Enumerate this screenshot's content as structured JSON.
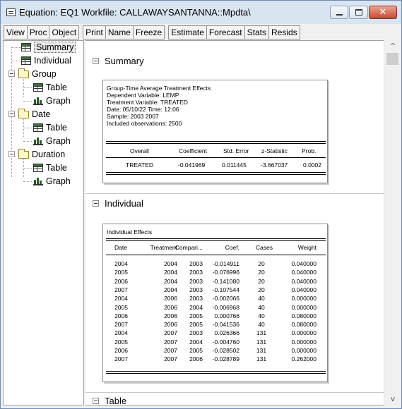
{
  "window": {
    "title": "Equation: EQ1   Workfile: CALLAWAYSANTANNA::Mpdta\\",
    "close_glyph": "✕"
  },
  "toolbar": {
    "group1": [
      "View",
      "Proc",
      "Object"
    ],
    "group2": [
      "Print",
      "Name",
      "Freeze"
    ],
    "group3": [
      "Estimate",
      "Forecast",
      "Stats",
      "Resids"
    ]
  },
  "tree": {
    "summary": "Summary",
    "individual": "Individual",
    "group": "Group",
    "group_table": "Table",
    "group_graph": "Graph",
    "date": "Date",
    "date_table": "Table",
    "date_graph": "Graph",
    "duration": "Duration",
    "duration_table": "Table",
    "duration_graph": "Graph"
  },
  "summary": {
    "heading": "Summary",
    "meta": [
      "Group-Time Average Treatment Effects",
      "Dependent Variable: LEMP",
      "Treatment Variable:  TREATED",
      "Date: 05/10/22   Time: 12:06",
      "Sample: 2003 2007",
      "Included observations: 2500"
    ],
    "columns": [
      "Overall",
      "Coefficient",
      "Std. Error",
      "z-Statistic",
      "Prob."
    ],
    "row": [
      "TREATED",
      "-0.041969",
      "0.011445",
      "-3.667037",
      "0.0002"
    ]
  },
  "individual": {
    "heading": "Individual",
    "caption": "Individual Effects",
    "columns": [
      "Date",
      "Treatment",
      "Compari...",
      "Coef.",
      "Cases",
      "Weight"
    ],
    "rows": [
      [
        "2004",
        "2004",
        "2003",
        "-0.014911",
        "20",
        "0.040000"
      ],
      [
        "2005",
        "2004",
        "2003",
        "-0.076996",
        "20",
        "0.040000"
      ],
      [
        "2006",
        "2004",
        "2003",
        "-0.141080",
        "20",
        "0.040000"
      ],
      [
        "2007",
        "2004",
        "2003",
        "-0.107544",
        "20",
        "0.040000"
      ],
      [
        "2004",
        "2006",
        "2003",
        "-0.002066",
        "40",
        "0.000000"
      ],
      [
        "2005",
        "2006",
        "2004",
        "-0.006968",
        "40",
        "0.000000"
      ],
      [
        "2006",
        "2006",
        "2005",
        "0.000766",
        "40",
        "0.080000"
      ],
      [
        "2007",
        "2006",
        "2005",
        "-0.041536",
        "40",
        "0.080000"
      ],
      [
        "2004",
        "2007",
        "2003",
        "0.026366",
        "131",
        "0.000000"
      ],
      [
        "2005",
        "2007",
        "2004",
        "-0.004760",
        "131",
        "0.000000"
      ],
      [
        "2006",
        "2007",
        "2005",
        "-0.028502",
        "131",
        "0.000000"
      ],
      [
        "2007",
        "2007",
        "2006",
        "-0.028789",
        "131",
        "0.262000"
      ]
    ]
  },
  "table_section": {
    "heading": "Table"
  },
  "scrollbar": {
    "up": "^",
    "down": "v"
  }
}
